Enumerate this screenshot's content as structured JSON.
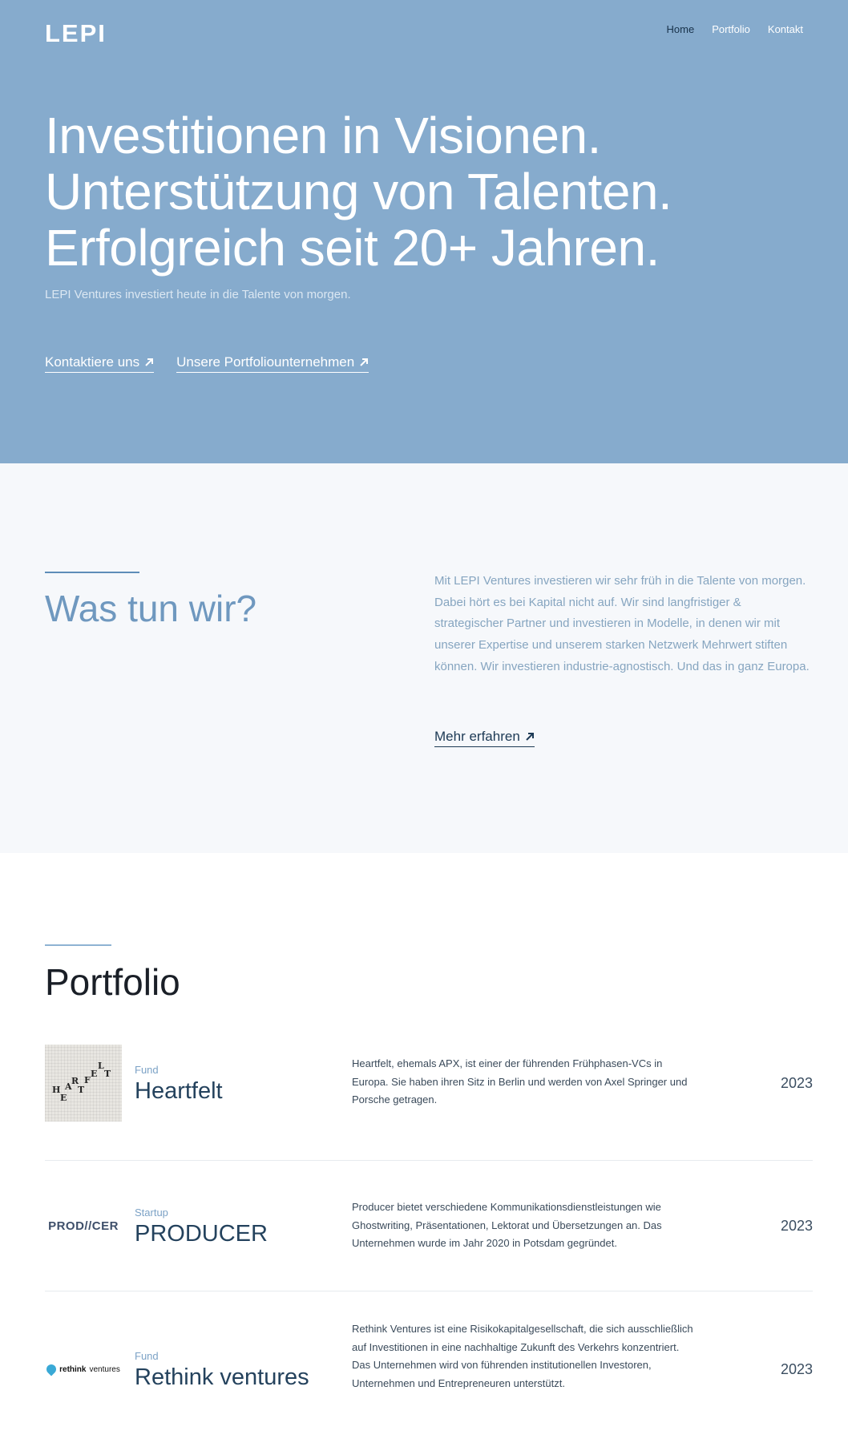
{
  "header": {
    "logo": "LEPI",
    "nav": [
      {
        "label": "Home",
        "active": true
      },
      {
        "label": "Portfolio",
        "active": false
      },
      {
        "label": "Kontakt",
        "active": false
      }
    ]
  },
  "hero": {
    "lines": [
      "Investitionen in Visionen.",
      "Unterstützung von Talenten.",
      "Erfolgreich seit 20+ Jahren."
    ],
    "subtitle": "LEPI Ventures investiert heute in die Talente von morgen.",
    "links": [
      {
        "label": "Kontaktiere uns"
      },
      {
        "label": "Unsere Portfoliounternehmen"
      }
    ]
  },
  "what": {
    "title": "Was tun wir?",
    "text": "Mit LEPI Ventures investieren wir sehr früh in die Talente von morgen. Dabei hört es bei Kapital nicht auf. Wir sind langfristiger & strategischer Partner und investieren in Modelle, in denen wir mit unserer Expertise und unserem starken Netzwerk Mehrwert stiften können. Wir investieren industrie-agnostisch. Und das in ganz Europa.",
    "link": "Mehr erfahren"
  },
  "portfolio": {
    "title": "Portfolio",
    "items": [
      {
        "type": "Fund",
        "name": "Heartfelt",
        "logo_letters": [
          "H",
          "E",
          "A",
          "R",
          "T",
          "F",
          "E",
          "L",
          "T"
        ],
        "description": "Heartfelt, ehemals APX, ist einer der führenden Frühphasen-VCs in Europa. Sie haben ihren Sitz in Berlin und werden von Axel Springer und Porsche getragen.",
        "year": "2023"
      },
      {
        "type": "Startup",
        "name": "PRODUCER",
        "logo_text": "PROD//CER",
        "description": "Producer bietet verschiedene Kommunikationsdienstleistungen wie Ghostwriting, Präsentationen, Lektorat und Übersetzungen an. Das Unternehmen wurde im Jahr 2020 in Potsdam gegründet.",
        "year": "2023"
      },
      {
        "type": "Fund",
        "name": "Rethink ventures",
        "logo_bold": "rethink",
        "logo_light": "ventures",
        "description": "Rethink Ventures ist eine Risikokapitalgesellschaft, die sich ausschließlich auf Investitionen in eine nachhaltige Zukunft des Verkehrs konzentriert. Das Unternehmen wird von führenden institutionellen Investoren, Unternehmen und Entrepreneuren unterstützt.",
        "year": "2023"
      }
    ]
  },
  "colors": {
    "hero_bg": "#86abcd",
    "section_bg": "#f6f8fb",
    "accent": "#6f98bf",
    "dark_text": "#1d3a55"
  }
}
